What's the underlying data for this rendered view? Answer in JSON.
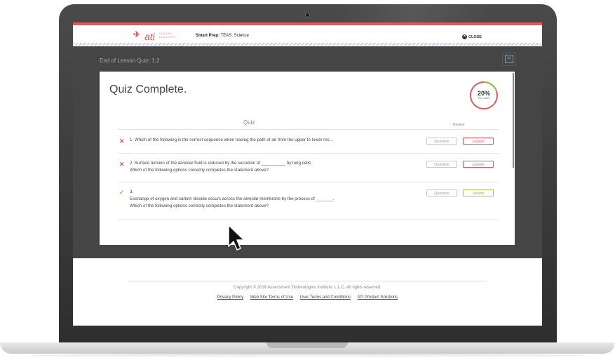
{
  "header": {
    "logo_text": "ati",
    "logo_subtext": "NURSING EDUCATION",
    "product_label": "Smart Prep:",
    "product_name": "TEAS: Science",
    "close_label": "CLOSE"
  },
  "modal": {
    "title": "End of Lesson Quiz: 1.2",
    "heading": "Quiz Complete.",
    "score_percent": "20%",
    "score_label": "Your Score",
    "score_fraction": 0.2,
    "column_quiz": "Quiz",
    "column_review": "Review",
    "question_button": "Question",
    "lesson_button": "Lesson",
    "questions": [
      {
        "status": "incorrect",
        "text": "1. Which of the following is the correct sequence when tracing the path of air from the upper to lower res..."
      },
      {
        "status": "incorrect",
        "text": "2. Surface tension of the alveolar fluid is reduced by the secretion of __________ by lung cells.\nWhich of the following options correctly completes the statement above?"
      },
      {
        "status": "correct",
        "text": "3.\nExchange of oxygen and carbon dioxide occurs across the alveolar membrane by the process of _______.\nWhich of the following options correctly completes the statement above?"
      }
    ]
  },
  "footer": {
    "copyright": "Copyright © 2016 Assessment Technologies Institute, L.L.C. All rights reserved.",
    "links": [
      "Privacy Policy",
      "Web Site Terms of Use",
      "User Terms and Conditions",
      "ATI Product Solutions"
    ]
  },
  "colors": {
    "accent_red": "#e5555a",
    "correct_green": "#8cc63f",
    "modal_backdrop": "#454545"
  }
}
